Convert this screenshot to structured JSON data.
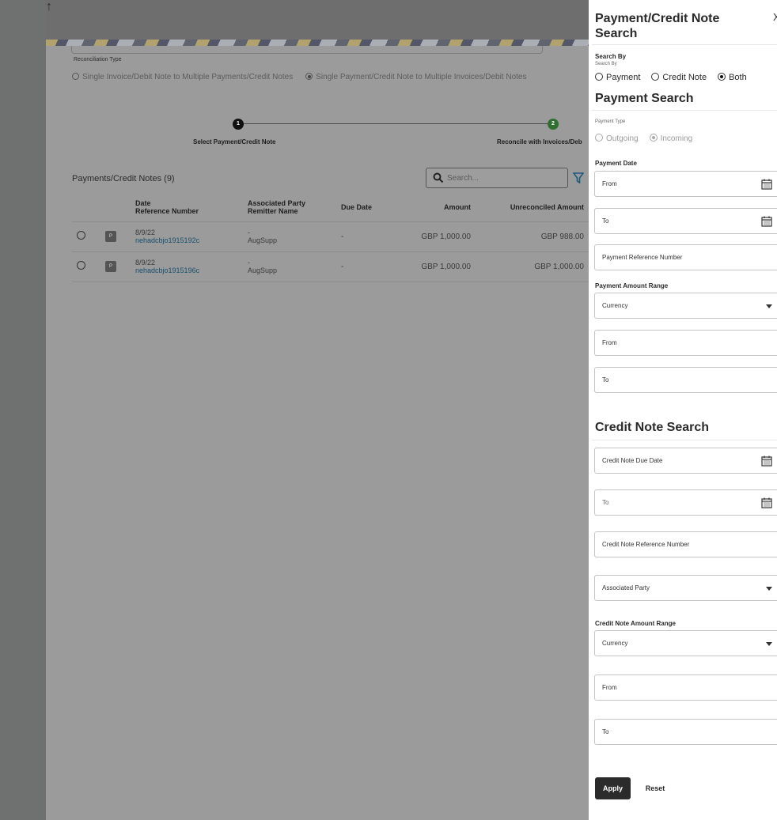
{
  "nav": {
    "scroll_top_glyph": "↑"
  },
  "main": {
    "reconciliation_type_label": "Reconciliation Type",
    "reconciliation_options": [
      {
        "label": "Single Invoice/Debit Note to Multiple Payments/Credit Notes",
        "selected": false
      },
      {
        "label": "Single Payment/Credit Note to Multiple Invoices/Debit Notes",
        "selected": true
      }
    ],
    "steps": [
      {
        "number": "1",
        "label": "Select Payment/Credit Note"
      },
      {
        "number": "2",
        "label": "Reconcile with Invoices/Deb"
      }
    ],
    "list_title": "Payments/Credit Notes (9)",
    "search_placeholder": "Search...",
    "columns": {
      "date": "Date",
      "reference": "Reference Number",
      "party": "Associated Party",
      "remitter": "Remitter Name",
      "due_date": "Due Date",
      "amount": "Amount",
      "unreconciled": "Unreconciled Amount"
    },
    "rows": [
      {
        "tag": "P",
        "date": "8/9/22",
        "reference": "nehadcbjo1915192c",
        "party": "-",
        "remitter": "AugSupp",
        "due_date": "-",
        "amount": "GBP 1,000.00",
        "unreconciled": "GBP 988.00"
      },
      {
        "tag": "P",
        "date": "8/9/22",
        "reference": "nehadcbjo1915196c",
        "party": "-",
        "remitter": "AugSupp",
        "due_date": "-",
        "amount": "GBP 1,000.00",
        "unreconciled": "GBP 1,000.00"
      }
    ]
  },
  "drawer": {
    "title": "Payment/Credit Note Search",
    "close_glyph": "X",
    "search_by_label": "Search By",
    "search_by_sublabel": "Search By",
    "search_by_options": [
      {
        "label": "Payment",
        "selected": false
      },
      {
        "label": "Credit Note",
        "selected": false
      },
      {
        "label": "Both",
        "selected": true
      }
    ],
    "payment_search_title": "Payment Search",
    "payment_type_label": "Payment Type",
    "payment_type_options": [
      {
        "label": "Outgoing",
        "selected": false
      },
      {
        "label": "Incoming",
        "selected": true
      }
    ],
    "payment_date_label": "Payment Date",
    "payment_date_from": "From",
    "payment_date_to": "To",
    "payment_reference": "Payment Reference Number",
    "payment_amount_range_label": "Payment Amount Range",
    "payment_currency": "Currency",
    "payment_amount_from": "From",
    "payment_amount_to": "To",
    "credit_note_search_title": "Credit Note Search",
    "credit_note_due_date": "Credit Note Due Date",
    "credit_note_due_to": "To",
    "credit_note_reference": "Credit Note Reference Number",
    "associated_party": "Associated Party",
    "credit_note_amount_range_label": "Credit Note Amount Range",
    "credit_note_currency": "Currency",
    "credit_note_amount_from": "From",
    "credit_note_amount_to": "To",
    "apply_label": "Apply",
    "reset_label": "Reset"
  }
}
